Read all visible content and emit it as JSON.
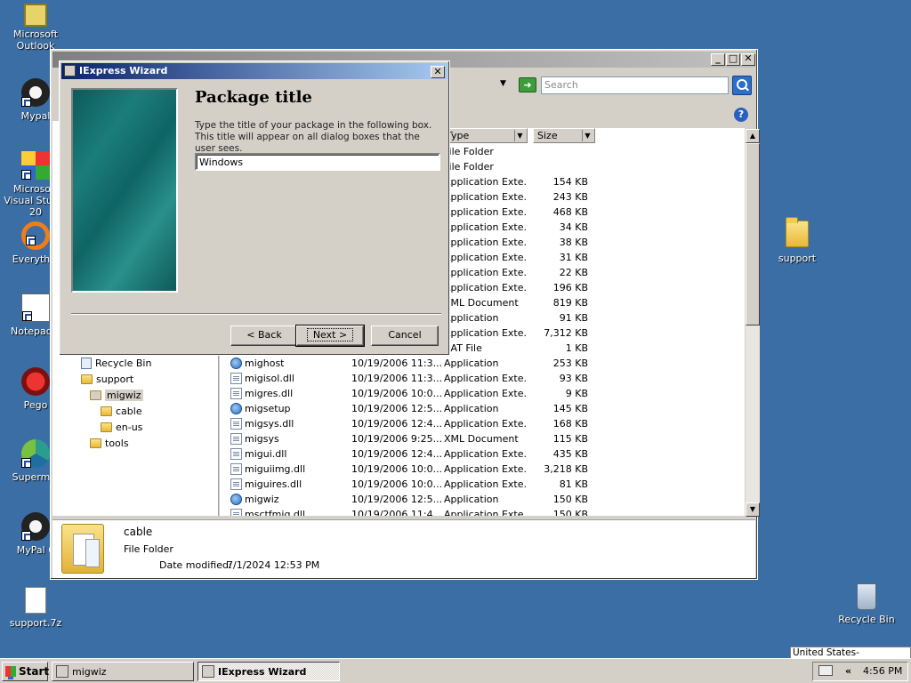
{
  "desktop": {
    "icons": [
      {
        "id": "outlook",
        "label": "Microsoft Outlook"
      },
      {
        "id": "mypal",
        "label": "Mypal"
      },
      {
        "id": "visual-studio",
        "label": "Microsoft Visual Studio 20"
      },
      {
        "id": "everything",
        "label": "Everythin"
      },
      {
        "id": "notepad",
        "label": "Notepad+"
      },
      {
        "id": "pego",
        "label": "Pego"
      },
      {
        "id": "supermium",
        "label": "Supermiu"
      },
      {
        "id": "mypal6",
        "label": "MyPal 6"
      },
      {
        "id": "support7z",
        "label": "support.7z"
      },
      {
        "id": "support-folder",
        "label": "support"
      },
      {
        "id": "recycle-bin",
        "label": "Recycle Bin"
      }
    ]
  },
  "explorer": {
    "search_placeholder": "Search",
    "tree": [
      {
        "label": "Recycle Bin"
      },
      {
        "label": "support"
      },
      {
        "label": "migwiz"
      },
      {
        "label": "cable"
      },
      {
        "label": "en-us"
      },
      {
        "label": "tools"
      }
    ],
    "columns": {
      "type": "Type",
      "size": "Size"
    },
    "rows": [
      {
        "name": "",
        "date": "",
        "type": "File Folder",
        "size": ""
      },
      {
        "name": "",
        "date": "",
        "type": "File Folder",
        "size": ""
      },
      {
        "name": "",
        "date": "",
        "type": "Application Exte...",
        "size": "154 KB"
      },
      {
        "name": "",
        "date": "",
        "type": "Application Exte...",
        "size": "243 KB"
      },
      {
        "name": "",
        "date": "",
        "type": "Application Exte...",
        "size": "468 KB"
      },
      {
        "name": "",
        "date": "",
        "type": "Application Exte...",
        "size": "34 KB"
      },
      {
        "name": "",
        "date": "",
        "type": "Application Exte...",
        "size": "38 KB"
      },
      {
        "name": "",
        "date": "",
        "type": "Application Exte...",
        "size": "31 KB"
      },
      {
        "name": "",
        "date": "",
        "type": "Application Exte...",
        "size": "22 KB"
      },
      {
        "name": "",
        "date": "",
        "type": "Application Exte...",
        "size": "196 KB"
      },
      {
        "name": "",
        "date": "",
        "type": "XML Document",
        "size": "819 KB"
      },
      {
        "name": "",
        "date": "",
        "type": "Application",
        "size": "91 KB"
      },
      {
        "name": "",
        "date": "",
        "type": "Application Exte...",
        "size": "7,312 KB"
      },
      {
        "name": "",
        "date": "",
        "type": "BAT File",
        "size": "1 KB"
      },
      {
        "name": "mighost",
        "date": "10/19/2006 11:3...",
        "type": "Application",
        "size": "253 KB"
      },
      {
        "name": "migisol.dll",
        "date": "10/19/2006 11:3...",
        "type": "Application Exte...",
        "size": "93 KB"
      },
      {
        "name": "migres.dll",
        "date": "10/19/2006 10:0...",
        "type": "Application Exte...",
        "size": "9 KB"
      },
      {
        "name": "migsetup",
        "date": "10/19/2006 12:5...",
        "type": "Application",
        "size": "145 KB"
      },
      {
        "name": "migsys.dll",
        "date": "10/19/2006 12:4...",
        "type": "Application Exte...",
        "size": "168 KB"
      },
      {
        "name": "migsys",
        "date": "10/19/2006 9:25...",
        "type": "XML Document",
        "size": "115 KB"
      },
      {
        "name": "migui.dll",
        "date": "10/19/2006 12:4...",
        "type": "Application Exte...",
        "size": "435 KB"
      },
      {
        "name": "miguiimg.dll",
        "date": "10/19/2006 10:0...",
        "type": "Application Exte...",
        "size": "3,218 KB"
      },
      {
        "name": "miguires.dll",
        "date": "10/19/2006 10:0...",
        "type": "Application Exte...",
        "size": "81 KB"
      },
      {
        "name": "migwiz",
        "date": "10/19/2006 12:5...",
        "type": "Application",
        "size": "150 KB"
      },
      {
        "name": "msctfmig.dll",
        "date": "10/19/2006 11:4...",
        "type": "Application Exte...",
        "size": "150 KB"
      }
    ],
    "details": {
      "name": "cable",
      "type": "File Folder",
      "modified_label": "Date modified:",
      "modified_value": "7/1/2024 12:53 PM"
    }
  },
  "wizard": {
    "title": "IExpress Wizard",
    "heading": "Package title",
    "description": "Type the title of your package in the following  box.  This title will appear on all dialog boxes that the user sees.",
    "input_value": "Windows",
    "back_label": "< Back",
    "next_label": "Next >",
    "cancel_label": "Cancel",
    "close_glyph": "✕"
  },
  "taskbar": {
    "start_label": "Start",
    "buttons": [
      {
        "label": "migwiz"
      },
      {
        "label": "IExpress Wizard"
      }
    ],
    "language": "United States-International",
    "tray_chevron": "«",
    "clock": "4:56 PM"
  }
}
